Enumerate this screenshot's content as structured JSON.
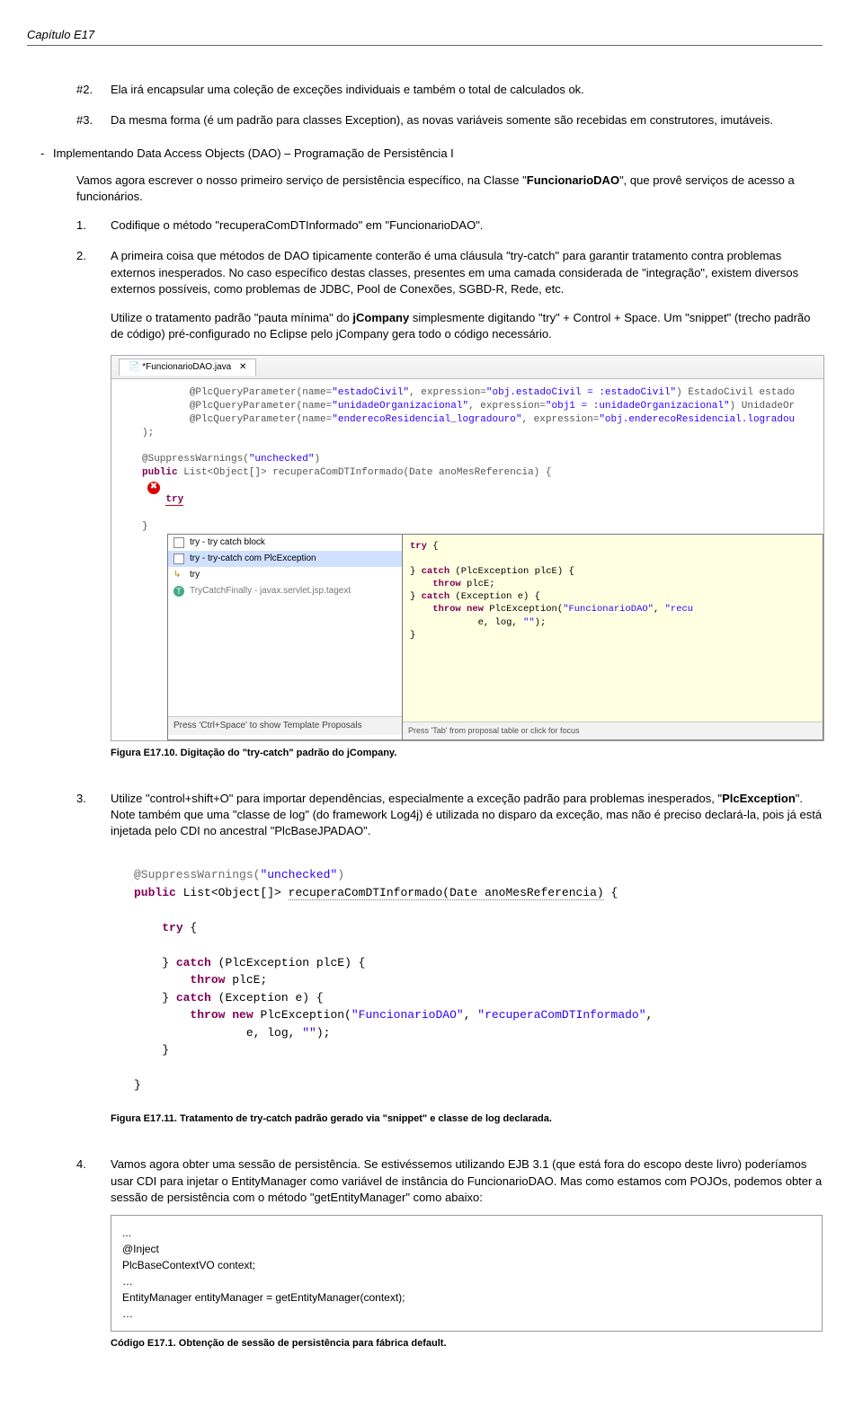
{
  "header": {
    "chapter": "Capítulo E17"
  },
  "items": {
    "i2_marker": "#2.",
    "i2_body": "Ela irá encapsular uma coleção de exceções individuais e também o total de calculados ok.",
    "i3_marker": "#3.",
    "i3_body": "Da mesma forma (é um padrão para classes Exception), as novas variáveis somente são recebidas em construtores, imutáveis."
  },
  "section": {
    "title": "Implementando Data Access Objects (DAO) – Programação de Persistência I",
    "intro_a": "Vamos agora escrever o nosso primeiro serviço de persistência específico, na Classe \"",
    "intro_bold": "FuncionarioDAO",
    "intro_b": "\", que provê serviços de acesso a funcionários."
  },
  "step1": {
    "marker": "1.",
    "body": "Codifique o método \"recuperaComDTInformado\"  em \"FuncionarioDAO\"."
  },
  "step2": {
    "marker": "2.",
    "p1": "A primeira coisa que métodos de DAO tipicamente conterão é uma cláusula \"try-catch\" para garantir tratamento contra problemas externos inesperados. No caso específico destas classes, presentes em uma camada considerada de \"integração\", existem diversos externos possíveis, como problemas de JDBC, Pool de Conexões, SGBD-R, Rede, etc.",
    "p2a": "Utilize o tratamento padrão \"pauta mínima\" do ",
    "p2bold": "jCompany",
    "p2b": " simplesmente digitando \"try\" + Control + Space. Um \"snippet\" (trecho padrão de código) pré-configurado no Eclipse pelo jCompany gera todo o código necessário."
  },
  "ide": {
    "tab": "*FuncionarioDAO.java",
    "ann1a": "@PlcQueryParameter(name=",
    "ann1s1": "\"estadoCivil\"",
    "ann1b": ", expression=",
    "ann1s2": "\"obj.estadoCivil = :estadoCivil\"",
    "ann1c": ") EstadoCivil estado",
    "ann2a": "@PlcQueryParameter(name=",
    "ann2s1": "\"unidadeOrganizacional\"",
    "ann2b": ", expression=",
    "ann2s2": "\"obj1 = :unidadeOrganizacional\"",
    "ann2c": ") UnidadeOr",
    "ann3a": "@PlcQueryParameter(name=",
    "ann3s1": "\"enderecoResidencial_logradouro\"",
    "ann3b": ", expression=",
    "ann3s2": "\"obj.enderecoResidencial.logradou",
    "close": ");",
    "supp": "@SuppressWarnings(",
    "suppstr": "\"unchecked\"",
    "suppend": ")",
    "sig1": "public",
    "sig2": " List<Object[]> recuperaComDTInformado(Date anoMesReferencia) {",
    "tryword": "try",
    "brace": "}",
    "popup": {
      "row1": "try - try catch block",
      "row2": "try - try-catch com PlcException",
      "row3": "try",
      "row4": "TryCatchFinally - javax.servlet.jsp.tagext",
      "footer": "Press 'Ctrl+Space' to show Template Proposals"
    },
    "preview": {
      "l1": "try {",
      "l2a": "} ",
      "l2kw": "catch",
      "l2b": " (PlcException plcE) {",
      "l3kw": "throw",
      "l3b": " plcE;",
      "l4a": "} ",
      "l4kw": "catch",
      "l4b": " (Exception e) {",
      "l5kw": "throw new",
      "l5b": " PlcException(",
      "l5s1": "\"FuncionarioDAO\"",
      "l5c": ", ",
      "l5s2": "\"recu",
      "l6a": "e, log, ",
      "l6s": "\"\"",
      "l6b": ");",
      "l7": "}",
      "footer": "Press 'Tab' from proposal table or click for focus"
    }
  },
  "fig1_caption": "Figura E17.10. Digitação do \"try-catch\" padrão do jCompany.",
  "step3": {
    "marker": "3.",
    "a": "Utilize \"control+shift+O\" para importar dependências, especialmente a exceção padrão para problemas inesperados, \"",
    "bold": "PlcException",
    "b": "\". Note também que uma \"classe de log\" (do framework Log4j) é utilizada no disparo da exceção, mas não é preciso declará-la, pois já está injetada pelo CDI no ancestral \"PlcBaseJPADAO\"."
  },
  "code2": {
    "supp": "@SuppressWarnings(",
    "suppstr": "\"unchecked\"",
    "suppend": ")",
    "l1a": "public",
    "l1b": " List<Object[]> ",
    "l1u": "recuperaComDTInformado(Date anoMesReferencia)",
    "l1c": " {",
    "l2a": "try",
    "l2b": " {",
    "l3a": "} ",
    "l3kw": "catch",
    "l3b": " (PlcException plcE) {",
    "l4kw": "throw",
    "l4b": " plcE;",
    "l5a": "} ",
    "l5kw": "catch",
    "l5b": " (Exception e) {",
    "l6kw": "throw new",
    "l6b": " PlcException(",
    "l6s1": "\"FuncionarioDAO\"",
    "l6c": ", ",
    "l6s2": "\"recuperaComDTInformado\"",
    "l6d": ",",
    "l7a": "e, log, ",
    "l7s": "\"\"",
    "l7b": ");",
    "l8": "}",
    "l9": "}"
  },
  "fig2_caption": "Figura E17.11. Tratamento de try-catch padrão gerado via \"snippet\" e classe de log declarada.",
  "step4": {
    "marker": "4.",
    "body": "Vamos agora obter uma sessão de persistência. Se estivéssemos utilizando EJB 3.1 (que está fora do escopo deste livro) poderíamos usar CDI para injetar o EntityManager como variável de instância do FuncionarioDAO. Mas como estamos com POJOs, podemos obter a sessão de persistência com o método \"getEntityManager\" como abaixo:"
  },
  "codebox": {
    "text": "...\n@Inject\nPlcBaseContextVO context;\n…\nEntityManager entityManager = getEntityManager(context);\n…"
  },
  "code_caption": "Código E17.1. Obtenção de sessão de persistência para fábrica default."
}
